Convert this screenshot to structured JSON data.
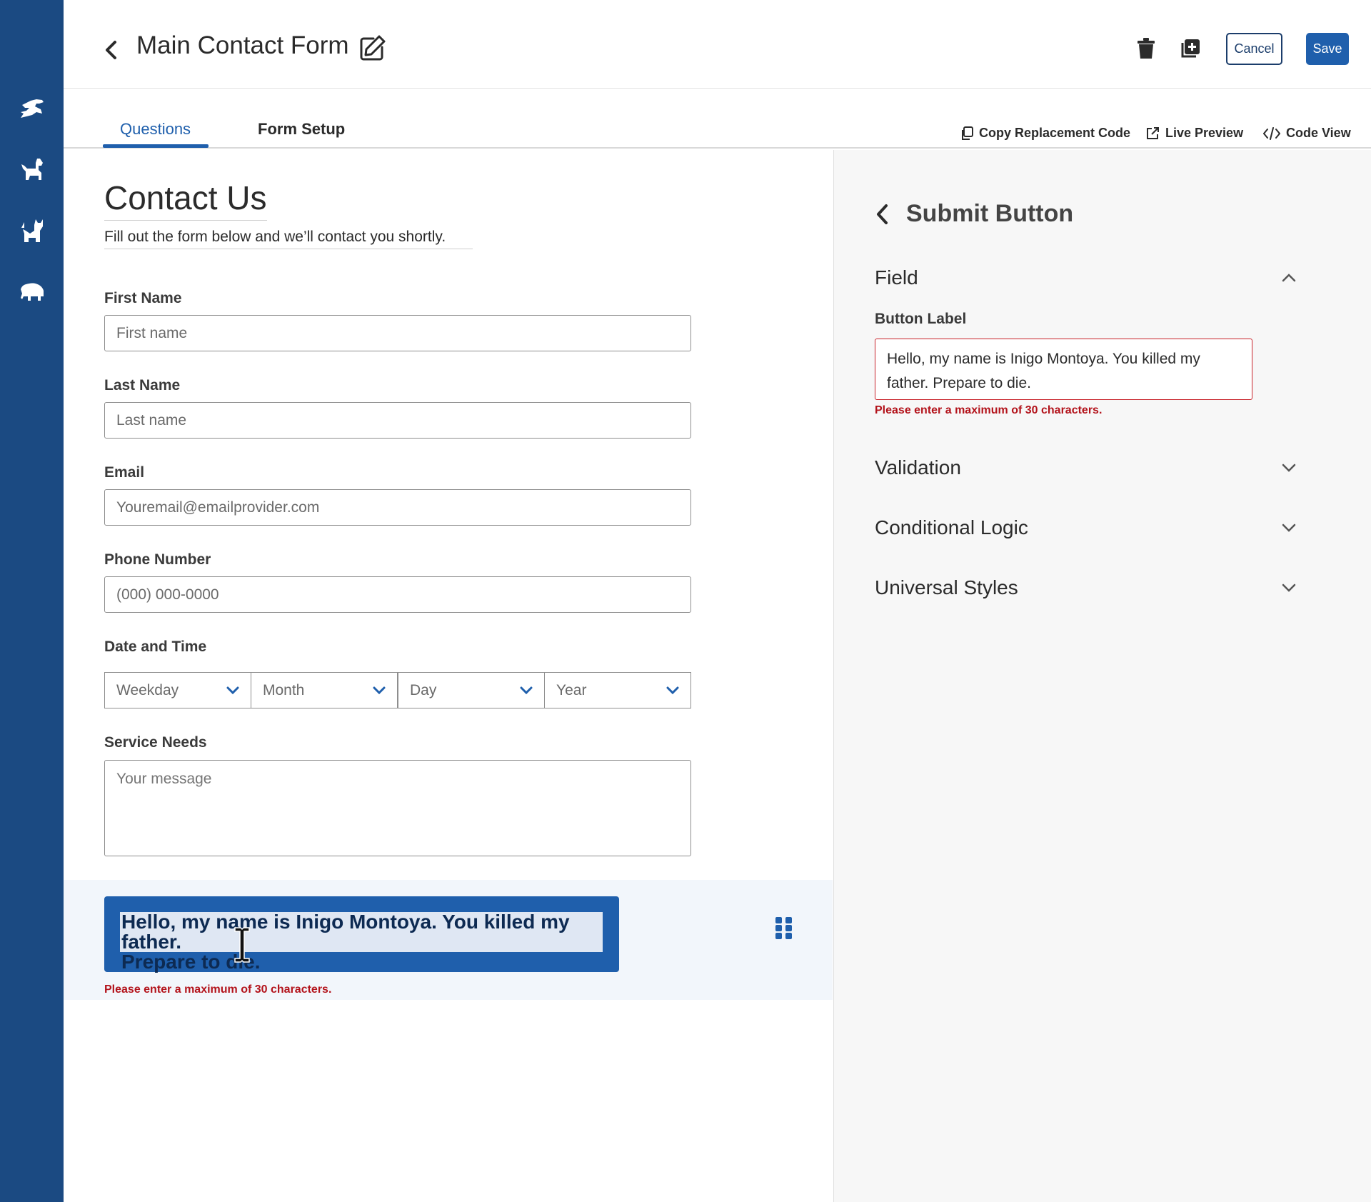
{
  "colors": {
    "rail": "#1b4a82",
    "primary": "#1f5fac",
    "error": "#b3131b",
    "panel_bg": "#f7f7f7"
  },
  "rail": {
    "icons": [
      "dinosaur-icon",
      "dog-icon",
      "cat-icon",
      "elephant-icon"
    ]
  },
  "header": {
    "title": "Main Contact Form",
    "cancel_label": "Cancel",
    "save_label": "Save"
  },
  "tabs": {
    "questions": "Questions",
    "form_setup": "Form Setup",
    "copy_code": "Copy Replacement Code",
    "live_preview": "Live Preview",
    "code_view": "Code View"
  },
  "form": {
    "title": "Contact Us",
    "subtitle": "Fill out the form below and we’ll contact you shortly.",
    "first_name": {
      "label": "First Name",
      "placeholder": "First name"
    },
    "last_name": {
      "label": "Last Name",
      "placeholder": "Last name"
    },
    "email": {
      "label": "Email",
      "placeholder": "Youremail@emailprovider.com"
    },
    "phone": {
      "label": "Phone Number",
      "placeholder": "(000) 000-0000"
    },
    "datetime": {
      "label": "Date and Time",
      "weekday": "Weekday",
      "month": "Month",
      "day": "Day",
      "year": "Year"
    },
    "service": {
      "label": "Service Needs",
      "placeholder": "Your message"
    },
    "submit": {
      "line1": "Hello, my name is Inigo Montoya. You killed my father.",
      "line2": "Prepare to die.",
      "error": "Please enter a maximum of 30 characters."
    }
  },
  "panel": {
    "title": "Submit Button",
    "field_section": "Field",
    "button_label_label": "Button Label",
    "button_label_line1": "Hello, my name is Inigo Montoya. You killed my",
    "button_label_line2": "father. Prepare to die.",
    "error": "Please enter a maximum of 30 characters.",
    "validation": "Validation",
    "conditional_logic": "Conditional Logic",
    "universal_styles": "Universal Styles"
  }
}
